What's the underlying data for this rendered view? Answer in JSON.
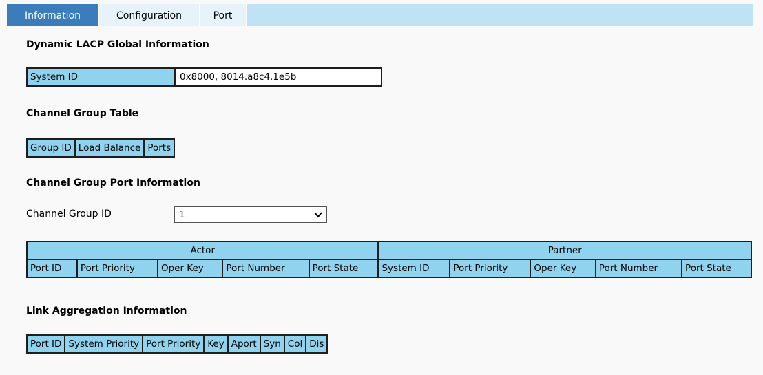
{
  "tabs": [
    {
      "label": "Information"
    },
    {
      "label": "Configuration"
    },
    {
      "label": "Port"
    }
  ],
  "global_info": {
    "title": "Dynamic LACP Global Information",
    "system_id_label": "System ID",
    "system_id_value": "0x8000, 8014.a8c4.1e5b"
  },
  "channel_group_table": {
    "title": "Channel Group Table",
    "headers": [
      "Group ID",
      "Load Balance",
      "Ports"
    ]
  },
  "channel_group_port_info": {
    "title": "Channel Group Port Information",
    "group_id_label": "Channel Group ID",
    "group_id_selected": "1",
    "actor_label": "Actor",
    "partner_label": "Partner",
    "headers": [
      "Port ID",
      "Port Priority",
      "Oper Key",
      "Port Number",
      "Port State",
      "System ID",
      "Port Priority",
      "Oper Key",
      "Port Number",
      "Port State"
    ]
  },
  "link_aggregation": {
    "title": "Link Aggregation Information",
    "headers": [
      "Port ID",
      "System Priority",
      "Port Priority",
      "Key",
      "Aport",
      "Syn",
      "Col",
      "Dis"
    ]
  },
  "colors": {
    "tab_active": "#3a7dba",
    "tab_bar": "#bfe3f5",
    "header_cell": "#8fd3ef"
  }
}
